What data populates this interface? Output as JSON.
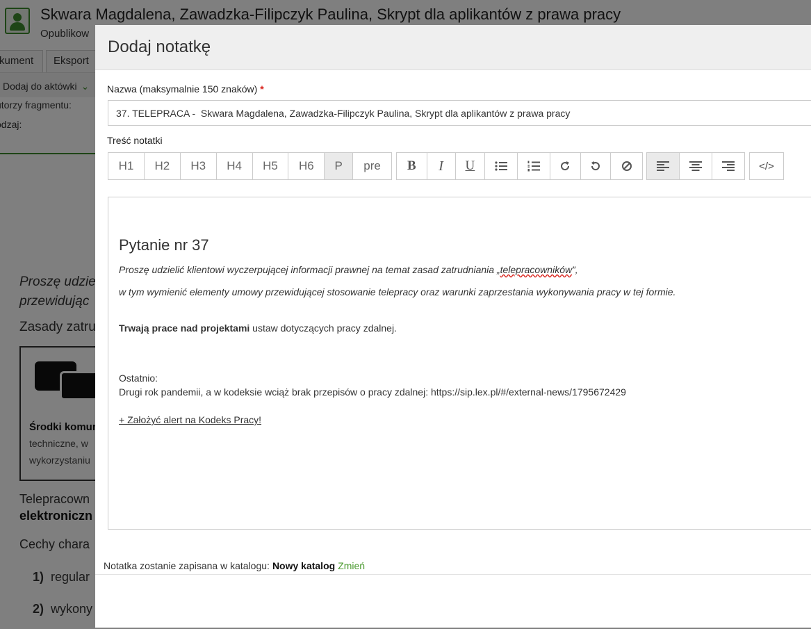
{
  "background": {
    "title": "Skwara Magdalena, Zawadzka-Filipczyk Paulina, Skrypt dla aplikantów z prawa pracy",
    "subtitle": "Opublikow",
    "tabs": [
      "kument",
      "Eksport"
    ],
    "add_to_folder": "Dodaj do aktówki",
    "meta_authors": "utorzy fragmentu:",
    "meta_type": "odzaj:",
    "question_line1": "Proszę udzie",
    "question_line2": "przewidując",
    "zasady": "Zasady zatru",
    "box_title": "Środki komun",
    "box_line1": "techniczne, w",
    "box_line2": "wykorzystaniu",
    "tele_line1": "Telepracown",
    "tele_line2": "elektroniczn",
    "cechy": "Cechy chara",
    "list": [
      {
        "num": "1)",
        "text": "regular"
      },
      {
        "num": "2)",
        "text": "wykony"
      }
    ]
  },
  "modal": {
    "title": "Dodaj notatkę",
    "name_label": "Nazwa (maksymalnie 150 znaków)",
    "required_mark": "*",
    "name_value": "37. TELEPRACA -  Skwara Magdalena, Zawadzka-Filipczyk Paulina, Skrypt dla aplikantów z prawa pracy",
    "content_label": "Treść notatki",
    "toolbar": {
      "headings": [
        "H1",
        "H2",
        "H3",
        "H4",
        "H5",
        "H6",
        "P",
        "pre"
      ],
      "active_heading": "P",
      "format": [
        "bold",
        "italic",
        "underline",
        "bullet-list",
        "numbered-list",
        "redo",
        "undo",
        "clear-format"
      ],
      "bold_label": "B",
      "italic_label": "I",
      "underline_label": "U",
      "align": [
        "align-left",
        "align-center",
        "align-right"
      ],
      "active_align": "align-left",
      "code_label": "</>"
    },
    "editor": {
      "heading": "Pytanie nr 37",
      "question_line1_a": "Proszę udzielić klientowi wyczerpującej informacji prawnej na temat zasad zatrudniania „",
      "question_line1_word": "telepracowników",
      "question_line1_b": "”,",
      "question_line2": "w tym wymienić elementy umowy przewidującej stosowanie telepracy oraz warunki zaprzestania wykonywania pracy w tej formie.",
      "bold_text": "Trwają prace nad projektami",
      "normal_text": " ustaw dotyczących pracy zdalnej.",
      "ostatnio": "Ostatnio:",
      "news": "Drugi rok pandemii, a w kodeksie wciąż brak przepisów o pracy zdalnej: https://sip.lex.pl/#/external-news/1795672429",
      "alert_link": "+ Założyć alert na Kodeks Pracy!"
    },
    "footer": {
      "note": "Notatka zostanie zapisana w katalogu:",
      "catalog": "Nowy katalog",
      "change": "Zmień"
    }
  },
  "colors": {
    "accent_green": "#4a9a2f",
    "required_red": "#d9231c",
    "overlay": "rgba(0,0,0,0.5)"
  }
}
